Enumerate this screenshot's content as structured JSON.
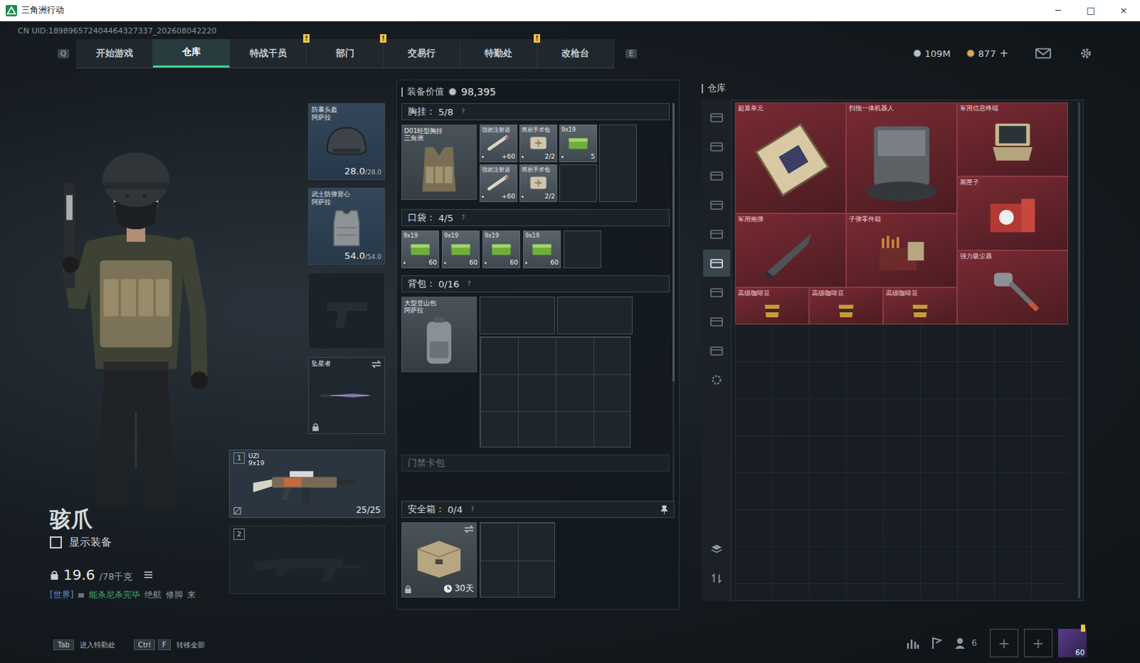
{
  "window": {
    "title": "三角洲行动",
    "controls": [
      "─",
      "□",
      "×"
    ]
  },
  "uid": "CN UID:189896572404464327337_202608042220",
  "nav": {
    "prev_key": "Q",
    "next_key": "E",
    "alert_mark": "!",
    "tabs": [
      {
        "label": "开始游戏",
        "selected": false,
        "alert": false
      },
      {
        "label": "仓库",
        "selected": true,
        "alert": false
      },
      {
        "label": "特战干员",
        "selected": false,
        "alert": true
      },
      {
        "label": "部门",
        "selected": false,
        "alert": true
      },
      {
        "label": "交易行",
        "selected": false,
        "alert": false
      },
      {
        "label": "特勤处",
        "selected": false,
        "alert": true
      },
      {
        "label": "改枪台",
        "selected": false,
        "alert": false
      }
    ]
  },
  "currencies": [
    {
      "amount": "109M",
      "kind": "coin",
      "add": ""
    },
    {
      "amount": "877",
      "kind": "gem",
      "add": "+"
    }
  ],
  "character": {
    "name": "骇爪",
    "show_equipment": {
      "label": "显示装备",
      "checked": false
    },
    "weight": "19.6",
    "weight_max": "/78千克"
  },
  "chat": {
    "channel": "[世界]",
    "sender": "能杀尼杀完毕",
    "messages": [
      "绝航",
      "修脚",
      "来"
    ]
  },
  "gear": [
    {
      "kind": "helmet",
      "name": "防暴头盔",
      "brand": "阿萨拉",
      "durability": "28.0",
      "durability_max": "/28.0",
      "empty": false,
      "locked": false,
      "swappable": false
    },
    {
      "kind": "armor",
      "name": "武士防弹背心",
      "brand": "阿萨拉",
      "durability": "54.0",
      "durability_max": "/54.0",
      "empty": false,
      "locked": false,
      "swappable": false
    },
    {
      "kind": "pistol",
      "empty": true,
      "locked": false,
      "swappable": false
    },
    {
      "kind": "melee",
      "name": "坠星者",
      "empty": false,
      "locked": true,
      "swappable": true
    }
  ],
  "weapons": [
    {
      "slot": "1",
      "name": "UZI",
      "caliber": "9x19",
      "ammo": "25/25",
      "empty": false
    },
    {
      "slot": "2",
      "empty": true
    }
  ],
  "loadout": {
    "value_label": "装备价值",
    "value": "98,395",
    "help": "?",
    "rig": {
      "label": "胸挂：",
      "count": "5/8",
      "item": {
        "name": "D01轻型胸挂",
        "brand": "三角洲"
      },
      "slots": [
        {
          "kind": "syringe",
          "name": "强效注射器",
          "value": "+60"
        },
        {
          "kind": "syringe",
          "name": "强效注射器",
          "value": "+60"
        },
        {
          "kind": "medkit",
          "name": "简易手术包",
          "value": "2/2"
        },
        {
          "kind": "medkit",
          "name": "简易手术包",
          "value": "2/2"
        },
        {
          "kind": "ammo",
          "name": "9x19",
          "value": "5"
        },
        {
          "kind": "empty"
        },
        {
          "kind": "empty"
        }
      ]
    },
    "pocket": {
      "label": "口袋：",
      "count": "4/5",
      "slots": [
        {
          "kind": "ammo",
          "name": "9x19",
          "value": "60"
        },
        {
          "kind": "ammo",
          "name": "9x19",
          "value": "60"
        },
        {
          "kind": "ammo",
          "name": "9x19",
          "value": "60"
        },
        {
          "kind": "ammo",
          "name": "9x19",
          "value": "60"
        },
        {
          "kind": "empty"
        }
      ]
    },
    "backpack": {
      "label": "背包：",
      "count": "0/16",
      "item": {
        "name": "大型登山包",
        "brand": "阿萨拉"
      }
    },
    "card_pack": {
      "label": "门禁卡包"
    },
    "safebox": {
      "label": "安全箱：",
      "count": "0/4",
      "timer": "30天",
      "locked": true,
      "swappable": true
    }
  },
  "warehouse": {
    "title": "仓库",
    "tabs": [
      {
        "selected": false
      },
      {
        "selected": false
      },
      {
        "selected": false
      },
      {
        "selected": false
      },
      {
        "selected": false
      },
      {
        "selected": true
      },
      {
        "selected": false
      },
      {
        "selected": false
      },
      {
        "selected": false
      }
    ],
    "items": [
      {
        "name": "超算单元",
        "kind": "board"
      },
      {
        "name": "扫拖一体机器人",
        "kind": "robot"
      },
      {
        "name": "军用信息终端",
        "kind": "terminal"
      },
      {
        "name": "黑匣子",
        "kind": "blackbox"
      },
      {
        "name": "军用炮弹",
        "kind": "shell"
      },
      {
        "name": "子弹零件箱",
        "kind": "partsbox"
      },
      {
        "name": "强力吸尘器",
        "kind": "vacuum"
      },
      {
        "name": "高级咖啡豆",
        "kind": "coffee"
      },
      {
        "name": "高级咖啡豆",
        "kind": "coffee"
      },
      {
        "name": "高级咖啡豆",
        "kind": "coffee"
      }
    ]
  },
  "hints": [
    {
      "keys": [
        "Tab"
      ],
      "label": "进入特勤处"
    },
    {
      "keys": [
        "Ctrl",
        "F"
      ],
      "label": "转移全部"
    }
  ],
  "social": {
    "friends": "6",
    "add_slots": [
      "+",
      "+"
    ],
    "avatar_level": "60"
  }
}
